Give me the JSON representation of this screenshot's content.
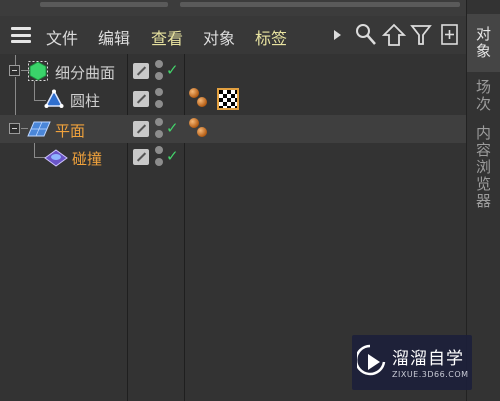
{
  "menu": {
    "items": [
      "文件",
      "编辑",
      "查看",
      "对象",
      "标签"
    ]
  },
  "objects": [
    {
      "name": "细分曲面",
      "color": "#e6e6e6",
      "icon": "subdivision-surface-icon",
      "checked": true,
      "tags": []
    },
    {
      "name": "圆柱",
      "color": "#e6e6e6",
      "icon": "cylinder-icon",
      "checked": false,
      "tags": [
        "material-ball-icon",
        "checker-texture-tag-icon"
      ]
    },
    {
      "name": "平面",
      "color": "#f0a23c",
      "icon": "plane-icon",
      "checked": true,
      "tags": [
        "material-ball-icon"
      ]
    },
    {
      "name": "碰撞",
      "color": "#f0a23c",
      "icon": "collision-deformer-icon",
      "checked": true,
      "tags": []
    }
  ],
  "sidebar": {
    "tabs": [
      "对象",
      "场次",
      "内容浏览器"
    ],
    "active": "对象"
  },
  "watermark": {
    "title": "溜溜自学",
    "url": "ZIXUE.3D66.COM"
  },
  "colors": {
    "accent_orange": "#f0a23c",
    "check_green": "#43d36b",
    "panel_bg": "#333333",
    "menubar_bg": "#383838"
  }
}
